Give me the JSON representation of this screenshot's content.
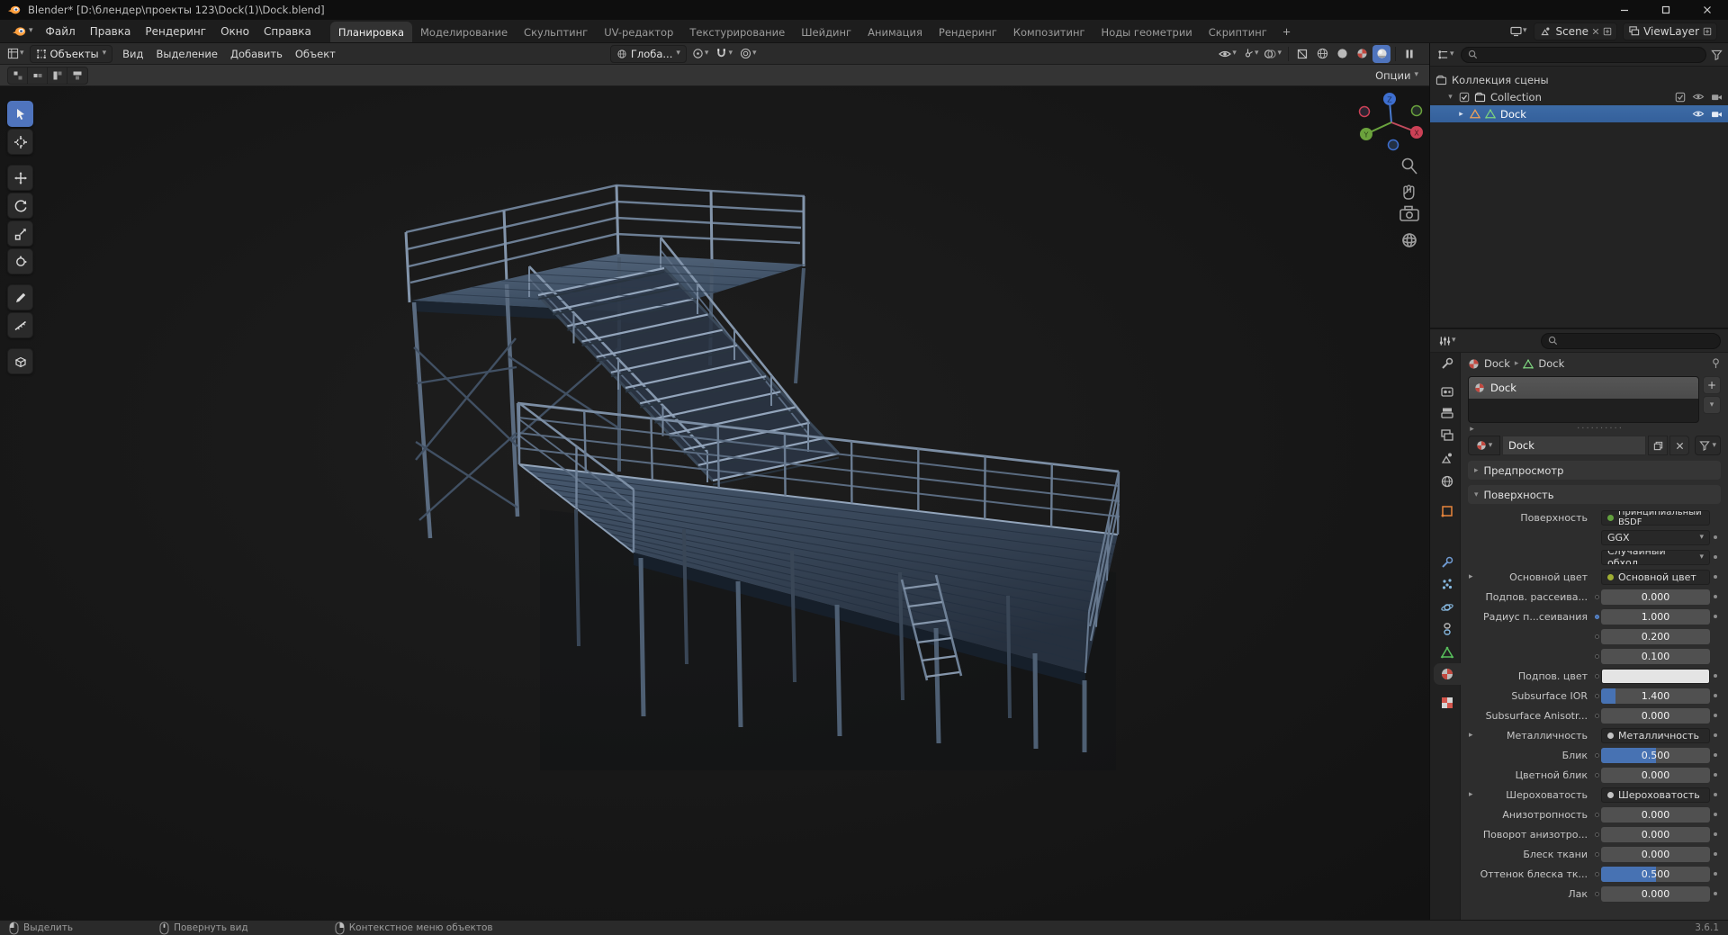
{
  "window": {
    "title": "Blender* [D:\\блендер\\проекты 123\\Dock(1)\\Dock.blend]"
  },
  "topbar": {
    "menus": [
      "Файл",
      "Правка",
      "Рендеринг",
      "Окно",
      "Справка"
    ],
    "workspaces": [
      "Планировка",
      "Моделирование",
      "Скульптинг",
      "UV-редактор",
      "Текстурирование",
      "Шейдинг",
      "Анимация",
      "Рендеринг",
      "Композитинг",
      "Ноды геометрии",
      "Скриптинг"
    ],
    "active_workspace": "Планировка",
    "add_tab": "+",
    "scene_label": "Scene",
    "view_layer_label": "ViewLayer"
  },
  "viewport": {
    "mode": "Объекты",
    "menus": [
      "Вид",
      "Выделение",
      "Добавить",
      "Объект"
    ],
    "orientation": "Глоба...",
    "options": "Опции",
    "shading_modes": [
      "wireframe",
      "solid",
      "material",
      "rendered"
    ],
    "active_shading": "rendered",
    "tools": [
      "select-box",
      "cursor",
      "move",
      "rotate",
      "scale",
      "transform",
      "annotate",
      "measure",
      "add-cube"
    ],
    "active_tool": "select-box"
  },
  "outliner": {
    "scene_collection": "Коллекция сцены",
    "collection": "Collection",
    "object": "Dock"
  },
  "properties": {
    "breadcrumb": {
      "object": "Dock",
      "data": "Dock"
    },
    "material_slot": "Dock",
    "material_name": "Dock",
    "preview_section": "Предпросмотр",
    "surface_section": "Поверхность",
    "tabs": [
      "tool",
      "render",
      "output",
      "view-layer",
      "scene",
      "world",
      "object",
      "modifiers",
      "particles",
      "physics",
      "constraints",
      "object-data",
      "material",
      "texture"
    ],
    "active_tab": "material",
    "rows": [
      {
        "type": "shader",
        "label": "Поверхность",
        "value": "Принципиальный BSDF",
        "socket": "#63a13e",
        "dot": false
      },
      {
        "type": "select",
        "label": "",
        "value": "GGX",
        "dot": true
      },
      {
        "type": "select",
        "label": "",
        "value": "Случайный обход",
        "dot": true
      },
      {
        "type": "link",
        "label": "Основной цвет",
        "value": "Основной цвет",
        "socket": "#9fae33",
        "collapse": true,
        "dot": true
      },
      {
        "type": "slider",
        "label": "Подпов. рассеива...",
        "value": "0.000",
        "fill": 0,
        "dot": true
      },
      {
        "type": "slider",
        "label": "Радиус п...сеивания",
        "value": "1.000",
        "fill": 0,
        "socket_blue": true,
        "dot": true
      },
      {
        "type": "slider",
        "label": "",
        "value": "0.200",
        "fill": 0,
        "dot": false
      },
      {
        "type": "slider",
        "label": "",
        "value": "0.100",
        "fill": 0,
        "dot": false
      },
      {
        "type": "color",
        "label": "Подпов. цвет",
        "value": "#e4e4e4",
        "dot": true
      },
      {
        "type": "slider",
        "label": "Subsurface IOR",
        "value": "1.400",
        "fill": 0.13,
        "dot": true
      },
      {
        "type": "slider",
        "label": "Subsurface Anisotr...",
        "value": "0.000",
        "fill": 0,
        "dot": true
      },
      {
        "type": "link",
        "label": "Металличность",
        "value": "Металличность",
        "socket": "#c4c4c4",
        "collapse": true,
        "dot": true
      },
      {
        "type": "slider",
        "label": "Блик",
        "value": "0.500",
        "fill": 0.5,
        "dot": true
      },
      {
        "type": "slider",
        "label": "Цветной блик",
        "value": "0.000",
        "fill": 0,
        "dot": true
      },
      {
        "type": "link",
        "label": "Шероховатость",
        "value": "Шероховатость",
        "socket": "#c4c4c4",
        "collapse": true,
        "dot": true
      },
      {
        "type": "slider",
        "label": "Анизотропность",
        "value": "0.000",
        "fill": 0,
        "dot": true
      },
      {
        "type": "slider",
        "label": "Поворот анизотро...",
        "value": "0.000",
        "fill": 0,
        "dot": true
      },
      {
        "type": "slider",
        "label": "Блеск ткани",
        "value": "0.000",
        "fill": 0,
        "dot": true
      },
      {
        "type": "slider",
        "label": "Оттенок блеска тк...",
        "value": "0.500",
        "fill": 0.5,
        "dot": true
      },
      {
        "type": "slider",
        "label": "Лак",
        "value": "0.000",
        "fill": 0,
        "dot": true
      }
    ]
  },
  "statusbar": {
    "hints": [
      "Выделить",
      "Повернуть вид",
      "Контекстное меню объектов"
    ],
    "version": "3.6.1"
  },
  "colors": {
    "accent": "#4772b3",
    "selection": "#3d6ba6",
    "object_orange": "#e8853c",
    "mesh_green": "#58c05c"
  },
  "icons": [
    "blender-logo",
    "search-icon",
    "filter-funnel-icon",
    "eye-icon",
    "render-visibility-camera-icon",
    "checkbox-icon",
    "collection-icon",
    "object-triangle-icon",
    "mesh-data-icon",
    "magnet-snap-icon",
    "proportional-editing-icon",
    "orientation-globe-icon",
    "pivot-icon",
    "overlays-icon",
    "gizmos-icon",
    "x-ray-icon",
    "shading-sphere-icons",
    "zoom-icon",
    "pan-hand-icon",
    "camera-view-icon",
    "orthographic-grid-icon",
    "axis-navigation-gizmo",
    "mouse-left-icon",
    "mouse-middle-icon",
    "mouse-right-icon",
    "pin-icon",
    "plus-icon",
    "caret-down-icon",
    "node-socket-dot",
    "keyframe-dot",
    "copy-icon",
    "close-x-icon",
    "nodes-icon"
  ]
}
